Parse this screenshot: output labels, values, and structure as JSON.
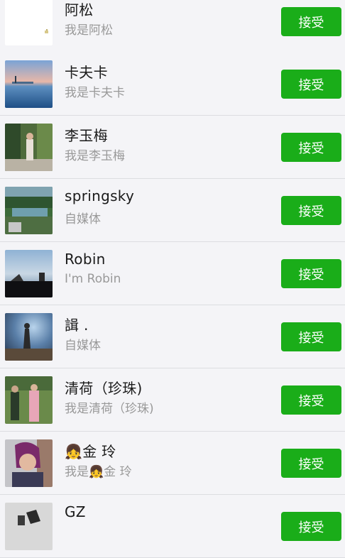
{
  "accept_label": "接受",
  "requests": [
    {
      "name": "阿松",
      "message": "我是阿松",
      "avatar_icon": "photo-white-avatar"
    },
    {
      "name": "卡夫卡",
      "message": "我是卡夫卡",
      "avatar_icon": "photo-sunset-sea"
    },
    {
      "name": "李玉梅",
      "message": "我是李玉梅",
      "avatar_icon": "photo-woman-garden"
    },
    {
      "name": "springsky",
      "message": "自媒体",
      "avatar_icon": "photo-forest-waterfall"
    },
    {
      "name": "Robin",
      "message": "I'm Robin",
      "avatar_icon": "photo-lakeside-dusk"
    },
    {
      "name": "諿 .",
      "message": "自媒体",
      "avatar_icon": "photo-silhouette-stars"
    },
    {
      "name": "清荷（珍珠)",
      "message": "我是清荷（珍珠)",
      "avatar_icon": "photo-couple-outdoor"
    },
    {
      "name": "👧金  玲",
      "message": "我是👧金  玲",
      "avatar_icon": "photo-woman-portrait"
    },
    {
      "name": "GZ",
      "message": "",
      "avatar_icon": "photo-dark-figure"
    }
  ]
}
